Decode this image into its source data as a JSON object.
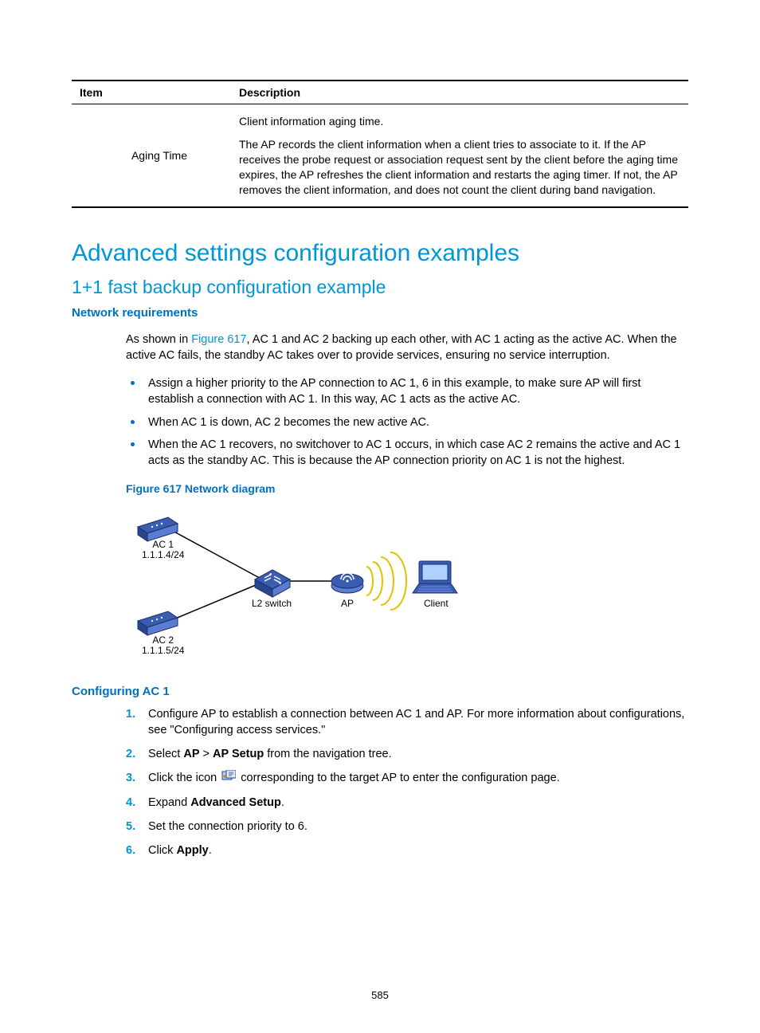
{
  "table": {
    "headers": [
      "Item",
      "Description"
    ],
    "row": {
      "item": "Aging Time",
      "desc1": "Client information aging time.",
      "desc2": "The AP records the client information when a client tries to associate to it. If the AP receives the probe request or association request sent by the client before the aging time expires, the AP refreshes the client information and restarts the aging timer. If not, the AP removes the client information, and does not count the client during band navigation."
    }
  },
  "h1": "Advanced settings configuration examples",
  "h2": "1+1 fast backup configuration example",
  "netreq_heading": "Network requirements",
  "intro_pre": "As shown in ",
  "intro_figref": "Figure 617",
  "intro_post": ", AC 1 and AC 2 backing up each other, with AC 1 acting as the active AC. When the active AC fails, the standby AC takes over to provide services, ensuring no service interruption.",
  "bullets": [
    "Assign a higher priority to the AP connection to AC 1, 6 in this example, to make sure AP will first establish a connection with AC 1. In this way, AC 1 acts as the active AC.",
    "When AC 1 is down, AC 2 becomes the new active AC.",
    "When the AC 1 recovers, no switchover to AC 1 occurs, in which case AC 2 remains the active and AC 1 acts as the standby AC. This is because the AP connection priority on AC 1 is not the highest."
  ],
  "figcap": "Figure 617 Network diagram",
  "diagram": {
    "ac1_name": "AC 1",
    "ac1_ip": "1.1.1.4/24",
    "ac2_name": "AC 2",
    "ac2_ip": "1.1.1.5/24",
    "switch": "L2 switch",
    "ap": "AP",
    "client": "Client"
  },
  "conf_heading": "Configuring AC 1",
  "steps": {
    "s1": "Configure AP to establish a connection between AC 1 and AP. For more information about configurations, see \"Configuring access services.\"",
    "s2_pre": "Select ",
    "s2_b1": "AP",
    "s2_mid": " > ",
    "s2_b2": "AP Setup",
    "s2_post": " from the navigation tree.",
    "s3_pre": "Click the icon ",
    "s3_post": " corresponding to the target AP to enter the configuration page.",
    "s4_pre": "Expand ",
    "s4_b": "Advanced Setup",
    "s4_post": ".",
    "s5": "Set the connection priority to 6.",
    "s6_pre": "Click ",
    "s6_b": "Apply",
    "s6_post": "."
  },
  "page_number": "585"
}
